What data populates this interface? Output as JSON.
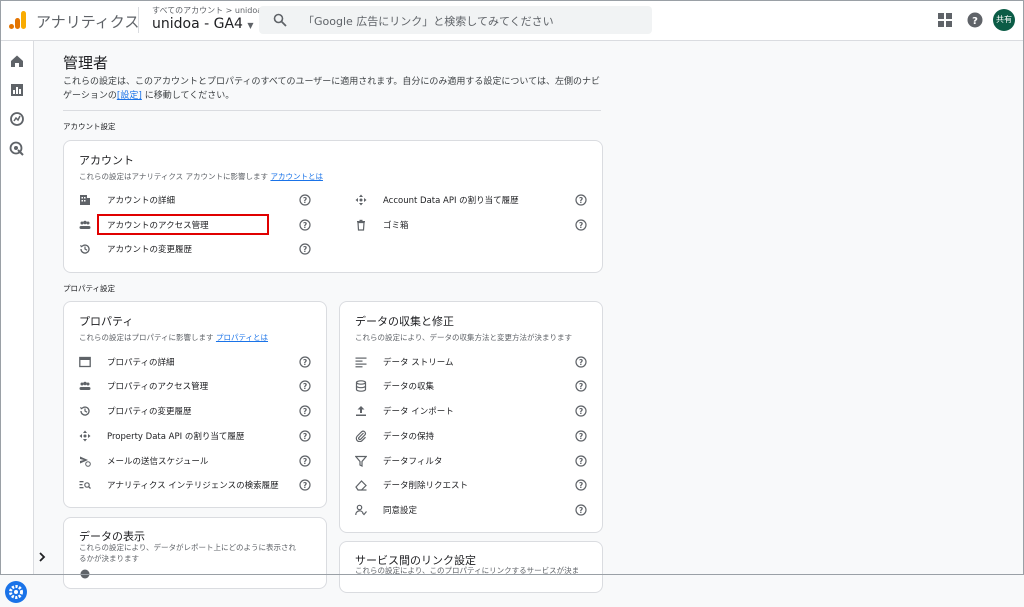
{
  "header": {
    "app_name": "アナリティクス",
    "breadcrumb": "すべてのアカウント > unidoa",
    "property_name": "unidoa - GA4",
    "search_placeholder": "「Google 広告にリンク」と検索してみてください",
    "avatar_text": "共有"
  },
  "page": {
    "title": "管理者",
    "description": "これらの設定は、このアカウントとプロパティのすべてのユーザーに適用されます。自分にのみ適用する設定については、左側のナビゲーションの",
    "description_link": "[設定]",
    "description_end": "に移動してください。"
  },
  "sections": {
    "account_label": "アカウント設定",
    "property_label": "プロパティ設定"
  },
  "account_card": {
    "title": "アカウント",
    "subtitle": "これらの設定はアナリティクス アカウントに影響します",
    "link": "アカウントとは",
    "items_left": [
      "アカウントの詳細",
      "アカウントのアクセス管理",
      "アカウントの変更履歴"
    ],
    "items_right": [
      "Account Data API の割り当て履歴",
      "ゴミ箱"
    ]
  },
  "property_card": {
    "title": "プロパティ",
    "subtitle": "これらの設定はプロパティに影響します",
    "link": "プロパティとは",
    "items": [
      "プロパティの詳細",
      "プロパティのアクセス管理",
      "プロパティの変更履歴",
      "Property Data API の割り当て履歴",
      "メールの送信スケジュール",
      "アナリティクス インテリジェンスの検索履歴"
    ]
  },
  "data_collection_card": {
    "title": "データの収集と修正",
    "subtitle": "これらの設定により、データの収集方法と変更方法が決まります",
    "items": [
      "データ ストリーム",
      "データの収集",
      "データ インポート",
      "データの保持",
      "データフィルタ",
      "データ削除リクエスト",
      "同意設定"
    ]
  },
  "data_display_card": {
    "title": "データの表示",
    "subtitle_1": "これらの設定により、データがレポート上にどのように表示され",
    "subtitle_2": "るかが決まります"
  },
  "link_card": {
    "title": "サービス間のリンク設定",
    "subtitle": "これらの設定により、このプロパティにリンクするサービスが決ま"
  },
  "colors": {
    "accent": "#1a73e8",
    "highlight": "#e00000",
    "avatar": "#0b5c46"
  }
}
